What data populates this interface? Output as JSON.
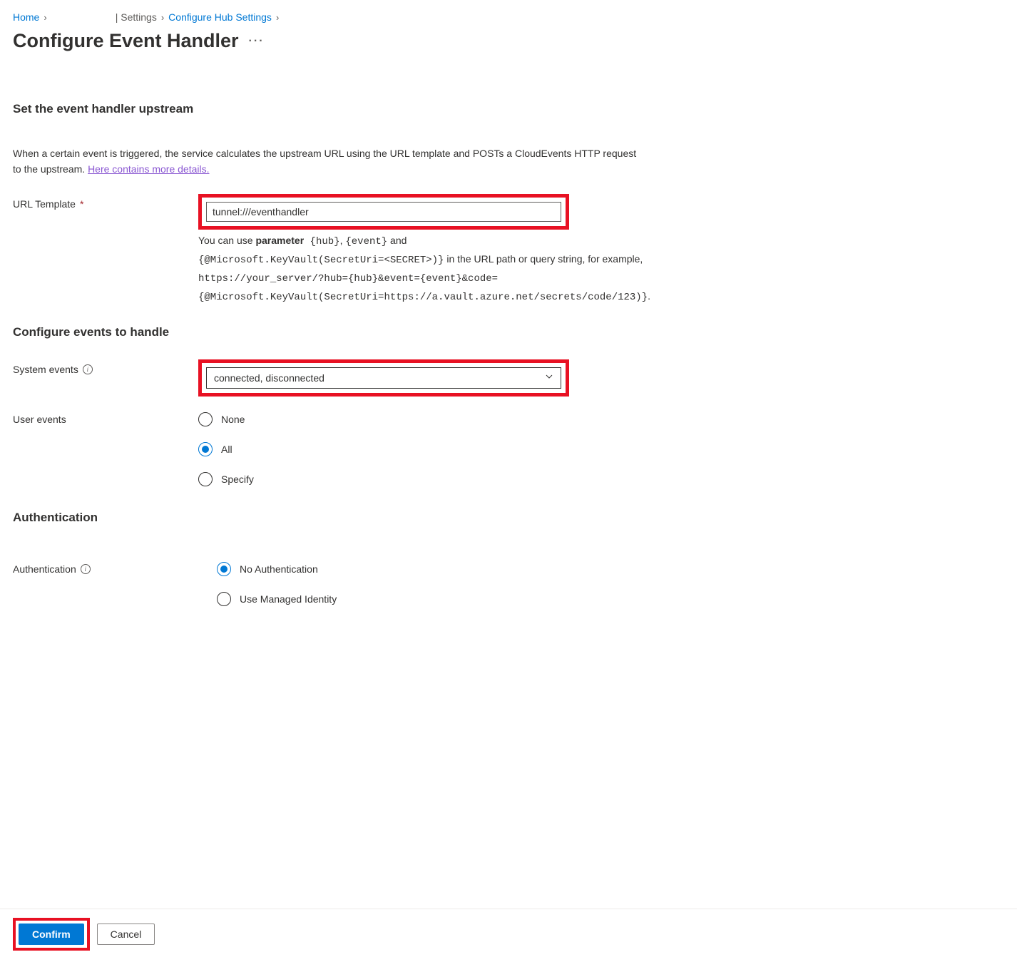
{
  "breadcrumb": {
    "home": "Home",
    "settings": "| Settings",
    "configure_hub": "Configure Hub Settings"
  },
  "page_title": "Configure Event Handler",
  "upstream": {
    "heading": "Set the event handler upstream",
    "description_pre": "When a certain event is triggered, the service calculates the upstream URL using the URL template and POSTs a CloudEvents HTTP request to the upstream. ",
    "description_link": "Here contains more details.",
    "url_template_label": "URL Template",
    "url_template_value": "tunnel:///eventhandler",
    "helper_line1_pre": "You can use ",
    "helper_line1_bold": "parameter",
    "helper_line1_mono1": " {hub}",
    "helper_line1_mid1": ", ",
    "helper_line1_mono2": "{event}",
    "helper_line1_mid2": " and ",
    "helper_line2_mono": "{@Microsoft.KeyVault(SecretUri=<SECRET>)}",
    "helper_line2_rest": " in the URL path or query string, for example, ",
    "helper_line3_mono": "https://your_server/?hub={hub}&event={event}&code={@Microsoft.KeyVault(SecretUri=https://a.vault.azure.net/secrets/code/123)}",
    "helper_line3_end": "."
  },
  "events": {
    "heading": "Configure events to handle",
    "system_events_label": "System events",
    "system_events_value": "connected, disconnected",
    "user_events_label": "User events",
    "user_events_options": {
      "none": "None",
      "all": "All",
      "specify": "Specify"
    }
  },
  "auth": {
    "heading": "Authentication",
    "label": "Authentication",
    "options": {
      "none": "No Authentication",
      "mid": "Use Managed Identity"
    }
  },
  "footer": {
    "confirm": "Confirm",
    "cancel": "Cancel"
  }
}
